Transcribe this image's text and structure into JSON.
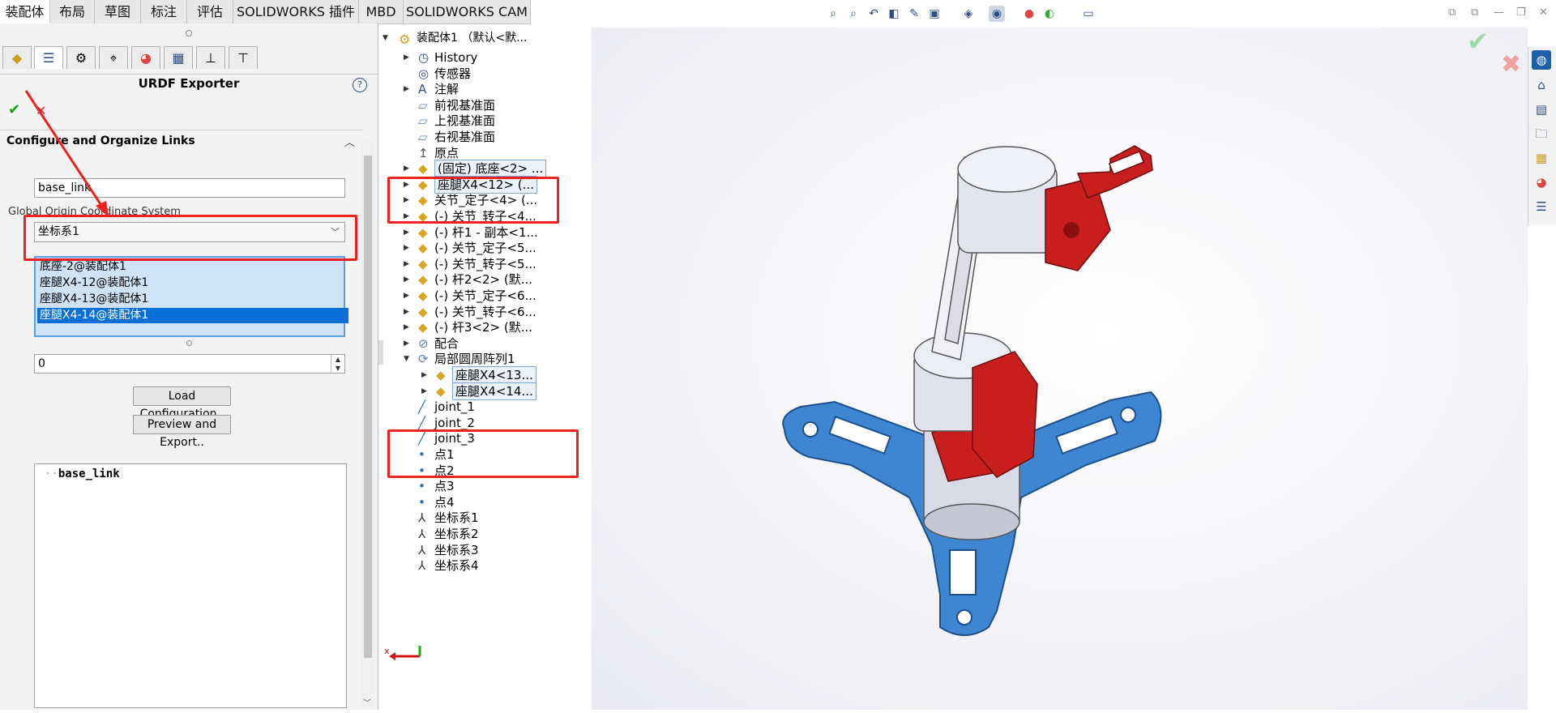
{
  "tabs": [
    "装配体",
    "布局",
    "草图",
    "标注",
    "评估",
    "SOLIDWORKS 插件",
    "MBD",
    "SOLIDWORKS CAM"
  ],
  "panel": {
    "title": "URDF Exporter",
    "help": "?",
    "ok": "✔",
    "cancel": "✕",
    "section_title": "Configure and Organize Links",
    "link_name": "base_link",
    "origin_label": "Global Origin Coordinate System",
    "origin_value": "坐标系1",
    "components": [
      "底座-2@装配体1",
      "座腿X4-12@装配体1",
      "座腿X4-13@装配体1",
      "座腿X4-14@装配体1"
    ],
    "selected_component_index": 3,
    "child_count": "0",
    "load_button": "Load Configuration..",
    "preview_button": "Preview and Export..",
    "link_tree_root": "base_link"
  },
  "tree": {
    "root": "装配体1 （默认<默...",
    "items": [
      {
        "label": "History",
        "icon": "history-icon",
        "arrow": "right"
      },
      {
        "label": "传感器",
        "icon": "sensor-icon",
        "arrow": ""
      },
      {
        "label": "注解",
        "icon": "annotation-icon",
        "arrow": "right"
      },
      {
        "label": "前视基准面",
        "icon": "plane-icon",
        "arrow": ""
      },
      {
        "label": "上视基准面",
        "icon": "plane-icon",
        "arrow": ""
      },
      {
        "label": "右视基准面",
        "icon": "plane-icon",
        "arrow": ""
      },
      {
        "label": "原点",
        "icon": "origin-icon",
        "arrow": ""
      },
      {
        "label": "(固定) 底座<2> ...",
        "icon": "part-icon",
        "arrow": "right",
        "boxed": true
      },
      {
        "label": "座腿X4<12> (...",
        "icon": "part-icon",
        "arrow": "right",
        "boxed": true
      },
      {
        "label": "关节_定子<4> (...",
        "icon": "part-icon",
        "arrow": "right"
      },
      {
        "label": "(-) 关节_转子<4...",
        "icon": "part-icon",
        "arrow": "right"
      },
      {
        "label": "(-) 杆1 - 副本<1...",
        "icon": "part-icon",
        "arrow": "right"
      },
      {
        "label": "(-) 关节_定子<5...",
        "icon": "part-icon",
        "arrow": "right"
      },
      {
        "label": "(-) 关节_转子<5...",
        "icon": "part-icon",
        "arrow": "right"
      },
      {
        "label": "(-) 杆2<2> (默...",
        "icon": "part-icon",
        "arrow": "right"
      },
      {
        "label": "(-) 关节_定子<6...",
        "icon": "part-icon",
        "arrow": "right"
      },
      {
        "label": "(-) 关节_转子<6...",
        "icon": "part-icon",
        "arrow": "right"
      },
      {
        "label": "(-) 杆3<2> (默...",
        "icon": "part-icon",
        "arrow": "right"
      },
      {
        "label": "配合",
        "icon": "mate-icon",
        "arrow": "right"
      },
      {
        "label": "局部圆周阵列1",
        "icon": "pattern-icon",
        "arrow": "down"
      },
      {
        "label": "座腿X4<13...",
        "icon": "part-icon",
        "arrow": "right",
        "boxed": true,
        "indent": 1
      },
      {
        "label": "座腿X4<14...",
        "icon": "part-icon",
        "arrow": "right",
        "boxed": true,
        "indent": 1
      },
      {
        "label": "joint_1",
        "icon": "axis-icon",
        "arrow": ""
      },
      {
        "label": "joint_2",
        "icon": "axis-icon",
        "arrow": ""
      },
      {
        "label": "joint_3",
        "icon": "axis-icon",
        "arrow": ""
      },
      {
        "label": "点1",
        "icon": "point-icon",
        "arrow": ""
      },
      {
        "label": "点2",
        "icon": "point-icon",
        "arrow": ""
      },
      {
        "label": "点3",
        "icon": "point-icon",
        "arrow": ""
      },
      {
        "label": "点4",
        "icon": "point-icon",
        "arrow": ""
      },
      {
        "label": "坐标系1",
        "icon": "coordinate-system-icon",
        "arrow": ""
      },
      {
        "label": "坐标系2",
        "icon": "coordinate-system-icon",
        "arrow": ""
      },
      {
        "label": "坐标系3",
        "icon": "coordinate-system-icon",
        "arrow": ""
      },
      {
        "label": "坐标系4",
        "icon": "coordinate-system-icon",
        "arrow": ""
      }
    ]
  },
  "triad_x_label": "x",
  "colors": {
    "accent_blue": "#0a6fd6",
    "highlight_red": "#ee2020",
    "model_blue": "#3f86d2",
    "model_red": "#c81e1e",
    "model_grey": "#d8dae6"
  }
}
